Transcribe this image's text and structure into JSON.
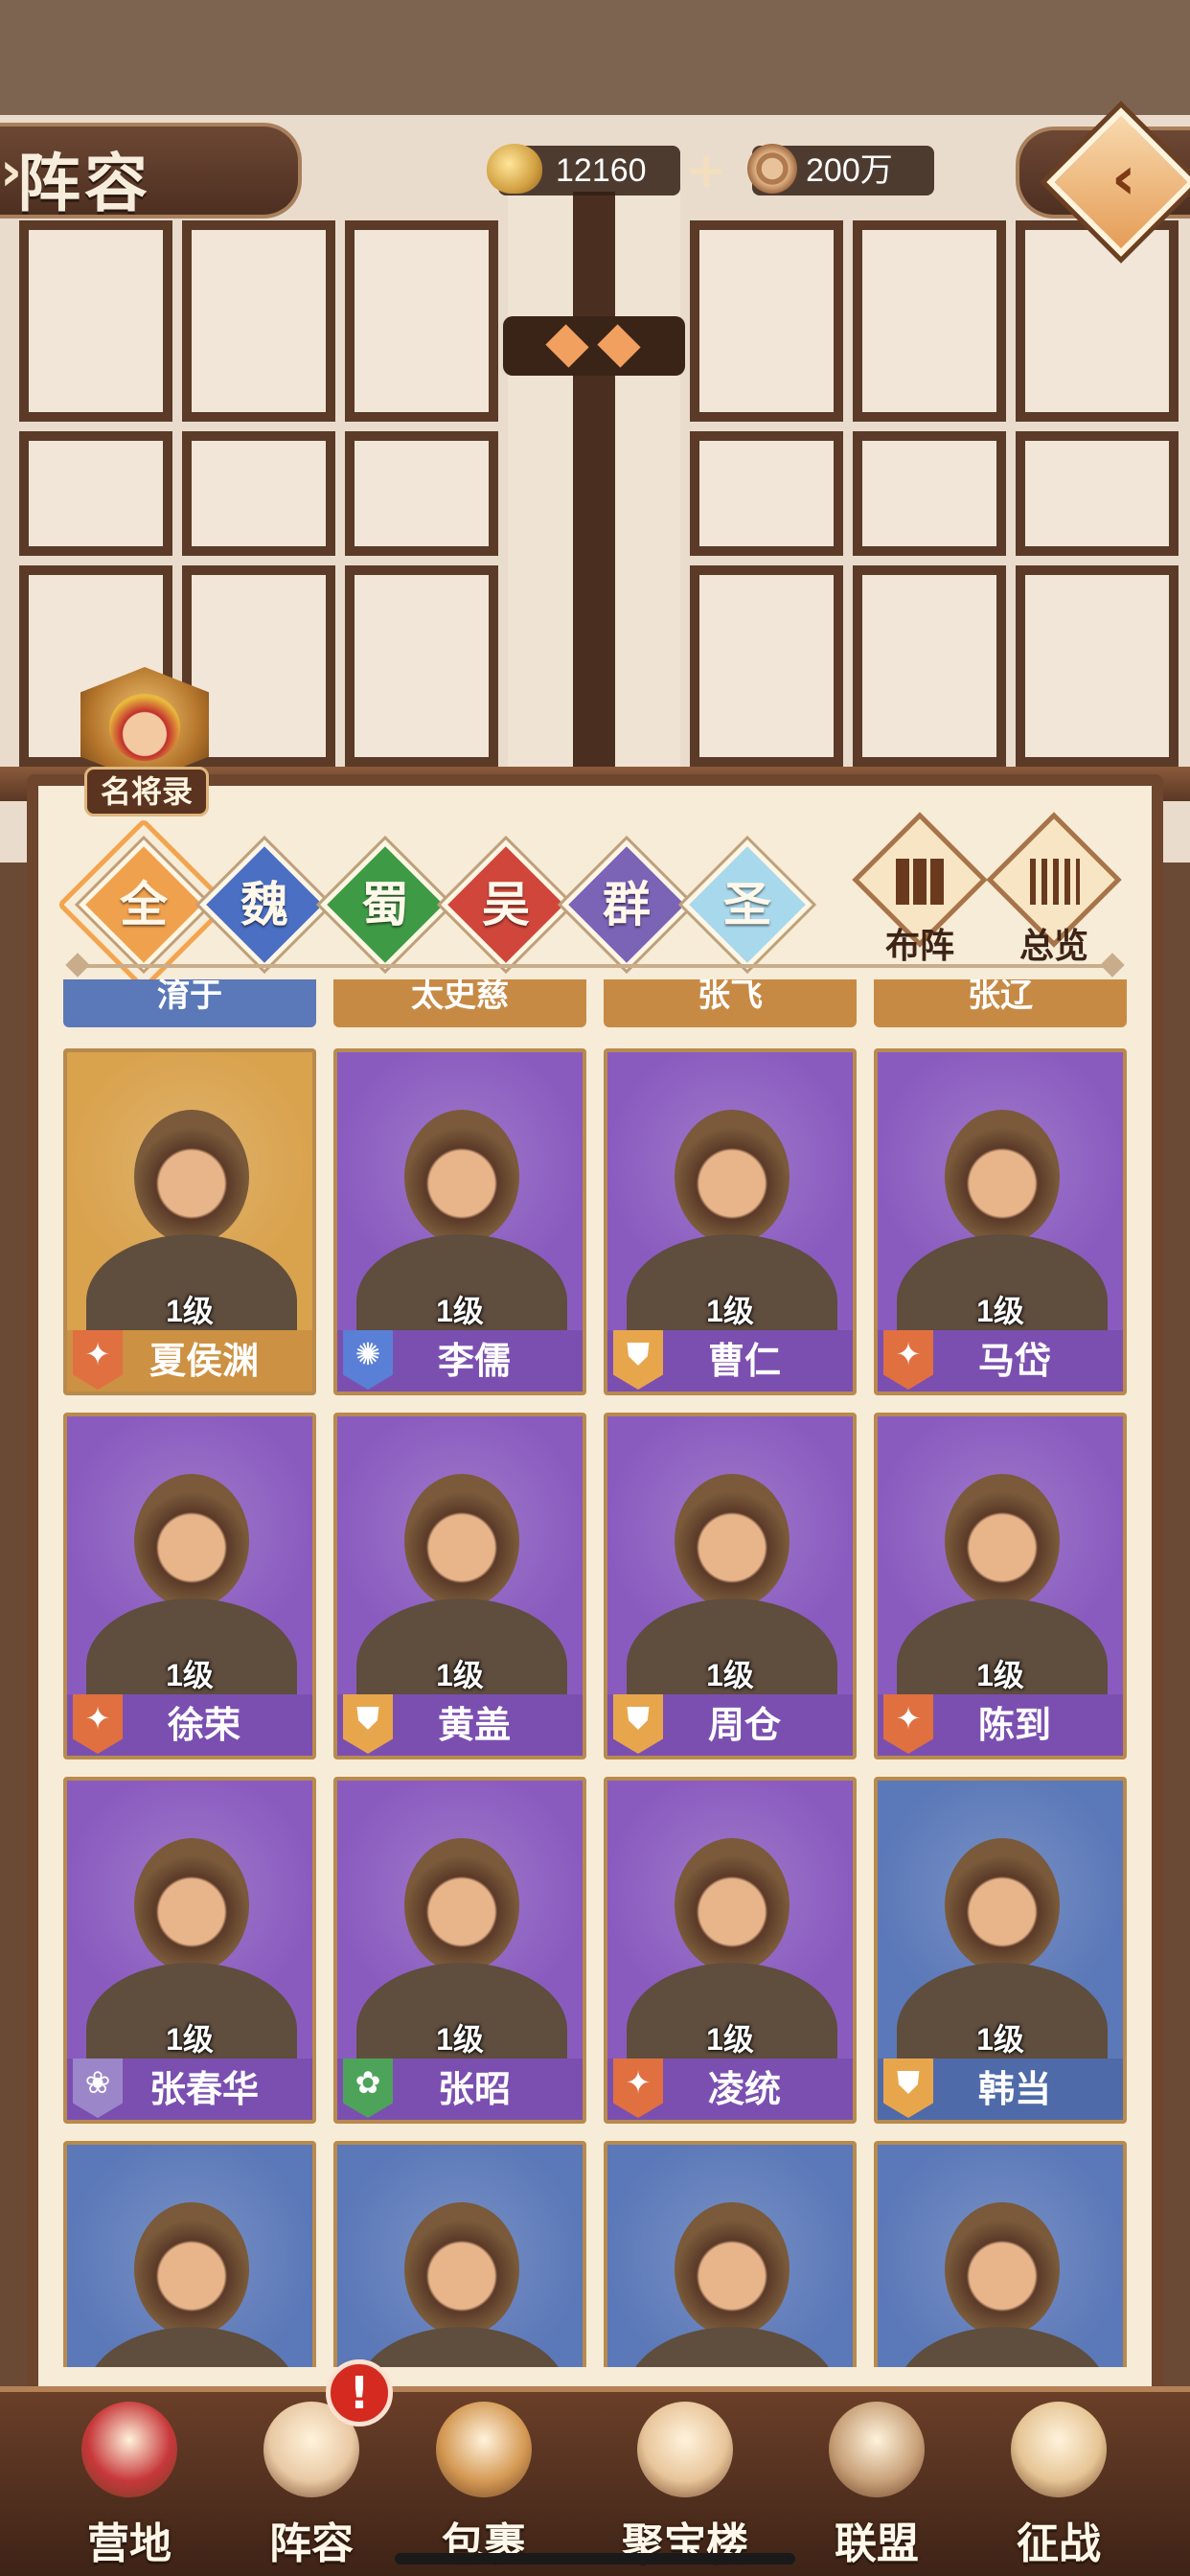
{
  "header": {
    "title": "阵容",
    "gold": "12160",
    "coins": "200万"
  },
  "panel": {
    "badge_label": "名将录",
    "tabs": [
      {
        "label": "全",
        "color": "#f0a14e",
        "active": true
      },
      {
        "label": "魏",
        "color": "#4a6fc3",
        "active": false
      },
      {
        "label": "蜀",
        "color": "#3f9a45",
        "active": false
      },
      {
        "label": "吴",
        "color": "#d0463b",
        "active": false
      },
      {
        "label": "群",
        "color": "#7b63b6",
        "active": false
      },
      {
        "label": "圣",
        "color": "#a8d8ec",
        "active": false
      }
    ],
    "side_buttons": [
      {
        "label": "布阵"
      },
      {
        "label": "总览"
      }
    ]
  },
  "peek_names": [
    "淯于",
    "太史慈",
    "张飞",
    "张辽"
  ],
  "cards": [
    {
      "name": "夏侯渊",
      "level": "1级",
      "role": "sword",
      "bg": "#d9a24d",
      "bar": "#cc9142",
      "faction": "gold"
    },
    {
      "name": "李儒",
      "level": "1级",
      "role": "flame",
      "bg": "#8a5bbf",
      "bar": "#7b4fb0"
    },
    {
      "name": "曹仁",
      "level": "1级",
      "role": "shield",
      "bg": "#8a5bbf",
      "bar": "#7b4fb0"
    },
    {
      "name": "马岱",
      "level": "1级",
      "role": "sword",
      "bg": "#8a5bbf",
      "bar": "#7b4fb0"
    },
    {
      "name": "徐荣",
      "level": "1级",
      "role": "sword",
      "bg": "#8a5bbf",
      "bar": "#7b4fb0"
    },
    {
      "name": "黄盖",
      "level": "1级",
      "role": "shield",
      "bg": "#8a5bbf",
      "bar": "#7b4fb0"
    },
    {
      "name": "周仓",
      "level": "1级",
      "role": "shield",
      "bg": "#8a5bbf",
      "bar": "#7b4fb0"
    },
    {
      "name": "陈到",
      "level": "1级",
      "role": "sword",
      "bg": "#8a5bbf",
      "bar": "#7b4fb0"
    },
    {
      "name": "张春华",
      "level": "1级",
      "role": "lotus",
      "bg": "#8a5bbf",
      "bar": "#7b4fb0"
    },
    {
      "name": "张昭",
      "level": "1级",
      "role": "leaf",
      "bg": "#8a5bbf",
      "bar": "#7b4fb0"
    },
    {
      "name": "凌统",
      "level": "1级",
      "role": "sword",
      "bg": "#8a5bbf",
      "bar": "#7b4fb0"
    },
    {
      "name": "韩当",
      "level": "1级",
      "role": "shield",
      "bg": "#5b78b8",
      "bar": "#4f6aa8"
    },
    {
      "name": "",
      "level": "",
      "role": "",
      "bg": "#5b78b8",
      "bar": "#4f6aa8"
    },
    {
      "name": "",
      "level": "",
      "role": "",
      "bg": "#5b78b8",
      "bar": "#4f6aa8"
    },
    {
      "name": "",
      "level": "",
      "role": "",
      "bg": "#5b78b8",
      "bar": "#4f6aa8"
    },
    {
      "name": "",
      "level": "",
      "role": "",
      "bg": "#5b78b8",
      "bar": "#4f6aa8"
    }
  ],
  "bottom_nav": [
    {
      "label": "营地",
      "icon": "camp-icon"
    },
    {
      "label": "阵容",
      "icon": "lineup-icon",
      "badge": "!"
    },
    {
      "label": "包裹",
      "icon": "bag-icon"
    },
    {
      "label": "聚宝楼",
      "icon": "treasure-tower-icon"
    },
    {
      "label": "联盟",
      "icon": "alliance-icon"
    },
    {
      "label": "征战",
      "icon": "battle-icon"
    }
  ],
  "role_colors": {
    "sword": "#e07040",
    "shield": "#e8a64c",
    "flame": "#5a7fd6",
    "lotus": "#9b86c9",
    "leaf": "#4ea35a"
  }
}
